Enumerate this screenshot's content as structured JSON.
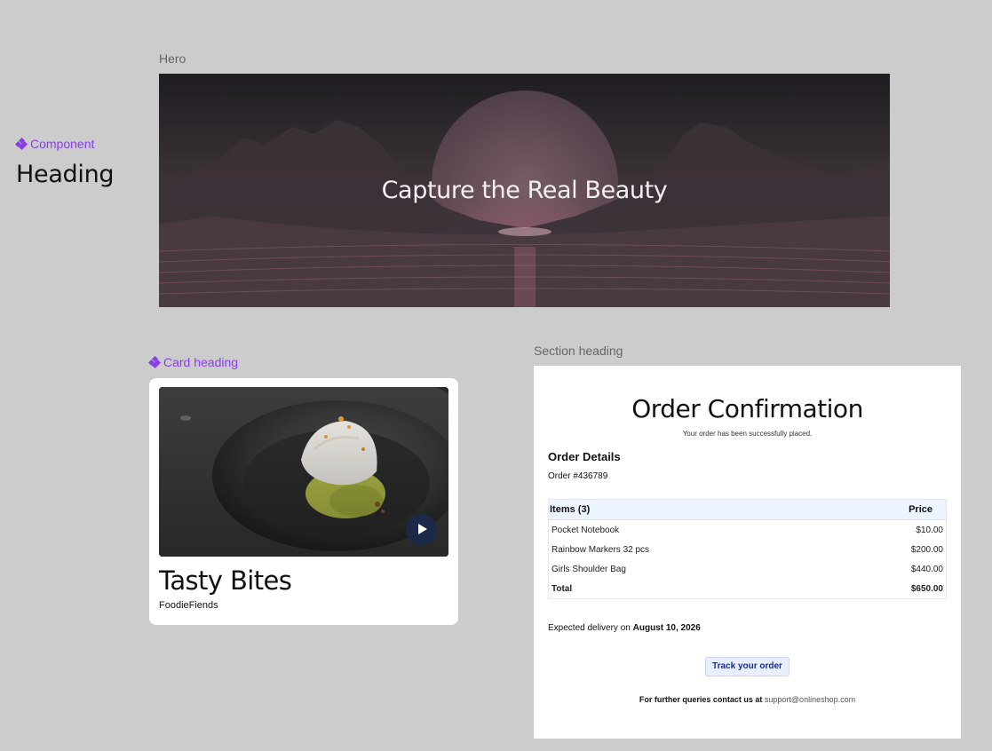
{
  "component": {
    "tag_label": "Component",
    "heading": "Heading"
  },
  "hero": {
    "frame_label": "Hero",
    "title": "Capture the Real Beauty"
  },
  "card": {
    "tag_label": "Card heading",
    "title": "Tasty Bites",
    "subtitle": "FoodieFiends",
    "play_icon": "play-icon"
  },
  "section": {
    "frame_label": "Section heading",
    "title": "Order Confirmation",
    "subtitle": "Your order has been successfully placed.",
    "details_title": "Order Details",
    "order_number": "Order #436789",
    "table": {
      "col_items": "Items (3)",
      "col_price": "Price",
      "rows": [
        {
          "name": "Pocket Notebook",
          "price": "$10.00"
        },
        {
          "name": "Rainbow Markers 32 pcs",
          "price": "$200.00"
        },
        {
          "name": "Girls Shoulder Bag",
          "price": "$440.00"
        }
      ],
      "total_label": "Total",
      "total_value": "$650.00"
    },
    "delivery_prefix": "Expected delivery on",
    "delivery_date": "August 10, 2026",
    "track_button": "Track your order",
    "contact_prefix": "For further queries contact us at",
    "contact_email": "support@onlineshop.com"
  },
  "colors": {
    "accent_purple": "#8a3ee8",
    "play_button": "#1c2a4a",
    "table_header": "#eef4ff"
  }
}
